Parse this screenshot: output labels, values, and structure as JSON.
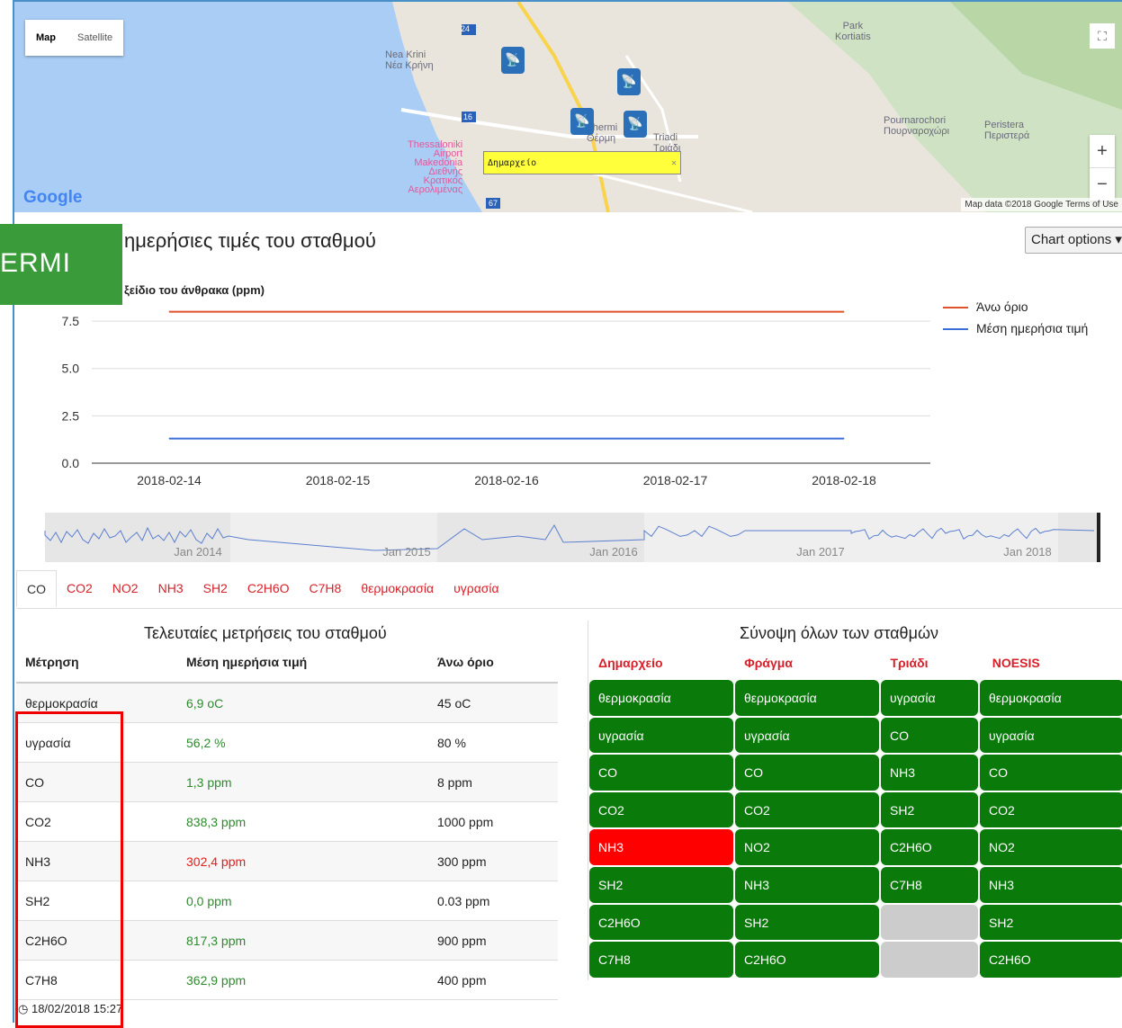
{
  "map": {
    "maptype_map": "Map",
    "maptype_satellite": "Satellite",
    "popup_label": "Δημαρχείο",
    "popup_close": "✕",
    "fullscreen_icon": "fullscreen-icon",
    "zoom_in": "+",
    "zoom_out": "−",
    "google_logo": "Google",
    "attribution": "Map data ©2018 Google   Terms of Use",
    "labels": {
      "nea_krini": "Nea Krini\nΝέα Κρήνη",
      "park": "Park\nKortiatis",
      "airport": "Thessaloniki\nAirport\nMakedonia\nΔιεθνής\nΚρατικός\nΑερολιμένας",
      "pournarochori": "Pournarochori\nΠουρναροχώρι",
      "peristera": "Peristera\nΠεριστερά",
      "triadi": "Triadi\nΤριάδι",
      "thermi": "Thermi\nΘέρμη",
      "road24": "24",
      "road16": "16",
      "road67": "67"
    }
  },
  "badge": "ERMI",
  "section_title": "ημερήσιες τιμές του σταθμού",
  "chart_options": "Chart options ▾",
  "chart_data": {
    "type": "line",
    "title": "ξείδιο του άνθρακα (ppm)",
    "x": [
      "2018-02-14",
      "2018-02-15",
      "2018-02-16",
      "2018-02-17",
      "2018-02-18"
    ],
    "series": [
      {
        "name": "Άνω όριο",
        "color": "#e0522c",
        "values": [
          8,
          8,
          8,
          8,
          8
        ]
      },
      {
        "name": "Μέση ημερήσια τιμή",
        "color": "#3c6ed8",
        "values": [
          1.3,
          1.3,
          1.3,
          1.3,
          1.3
        ]
      }
    ],
    "yticks": [
      "7.5",
      "5.0",
      "2.5",
      "0.0"
    ],
    "ylim": [
      0,
      9.5
    ],
    "navigator_labels": [
      "Jan 2014",
      "Jan 2015",
      "Jan 2016",
      "Jan 2017",
      "Jan 2018"
    ],
    "legend": "right"
  },
  "tabs": [
    "CO",
    "CO2",
    "NO2",
    "NH3",
    "SH2",
    "C2H6O",
    "C7H8",
    "θερμοκρασία",
    "υγρασία"
  ],
  "latest": {
    "title": "Τελευταίες μετρήσεις του σταθμού",
    "headers": [
      "Μέτρηση",
      "Μέση ημερήσια τιμή",
      "Άνω όριο"
    ],
    "rows": [
      {
        "name": "θερμοκρασία",
        "value": "6,9 oC",
        "limit": "45 oC",
        "status": "ok"
      },
      {
        "name": "υγρασία",
        "value": "56,2 %",
        "limit": "80 %",
        "status": "ok"
      },
      {
        "name": "CO",
        "value": "1,3 ppm",
        "limit": "8 ppm",
        "status": "ok"
      },
      {
        "name": "CO2",
        "value": "838,3 ppm",
        "limit": "1000 ppm",
        "status": "ok"
      },
      {
        "name": "NH3",
        "value": "302,4 ppm",
        "limit": "300 ppm",
        "status": "bad"
      },
      {
        "name": "SH2",
        "value": "0,0 ppm",
        "limit": "0.03 ppm",
        "status": "ok"
      },
      {
        "name": "C2H6O",
        "value": "817,3 ppm",
        "limit": "900 ppm",
        "status": "ok"
      },
      {
        "name": "C7H8",
        "value": "362,9 ppm",
        "limit": "400 ppm",
        "status": "ok"
      }
    ],
    "timestamp": "18/02/2018 15:27"
  },
  "summary": {
    "title": "Σύνοψη όλων των σταθμών",
    "stations": [
      "Δημαρχείο",
      "Φράγμα",
      "Τριάδι",
      "NOESIS"
    ],
    "rows": [
      [
        {
          "t": "θερμοκρασία",
          "s": "ok"
        },
        {
          "t": "θερμοκρασία",
          "s": "ok"
        },
        {
          "t": "υγρασία",
          "s": "ok"
        },
        {
          "t": "θερμοκρασία",
          "s": "ok"
        }
      ],
      [
        {
          "t": "υγρασία",
          "s": "ok"
        },
        {
          "t": "υγρασία",
          "s": "ok"
        },
        {
          "t": "CO",
          "s": "ok"
        },
        {
          "t": "υγρασία",
          "s": "ok"
        }
      ],
      [
        {
          "t": "CO",
          "s": "ok"
        },
        {
          "t": "CO",
          "s": "ok"
        },
        {
          "t": "NH3",
          "s": "ok"
        },
        {
          "t": "CO",
          "s": "ok"
        }
      ],
      [
        {
          "t": "CO2",
          "s": "ok"
        },
        {
          "t": "CO2",
          "s": "ok"
        },
        {
          "t": "SH2",
          "s": "ok"
        },
        {
          "t": "CO2",
          "s": "ok"
        }
      ],
      [
        {
          "t": "NH3",
          "s": "bad"
        },
        {
          "t": "NO2",
          "s": "ok"
        },
        {
          "t": "C2H6O",
          "s": "ok"
        },
        {
          "t": "NO2",
          "s": "ok"
        }
      ],
      [
        {
          "t": "SH2",
          "s": "ok"
        },
        {
          "t": "NH3",
          "s": "ok"
        },
        {
          "t": "C7H8",
          "s": "ok"
        },
        {
          "t": "NH3",
          "s": "ok"
        }
      ],
      [
        {
          "t": "C2H6O",
          "s": "ok"
        },
        {
          "t": "SH2",
          "s": "ok"
        },
        {
          "t": "",
          "s": "none"
        },
        {
          "t": "SH2",
          "s": "ok"
        }
      ],
      [
        {
          "t": "C7H8",
          "s": "ok"
        },
        {
          "t": "C2H6O",
          "s": "ok"
        },
        {
          "t": "",
          "s": "none"
        },
        {
          "t": "C2H6O",
          "s": "ok"
        }
      ]
    ]
  },
  "colors": {
    "ok": "#0a7a0a",
    "bad": "#ff0000",
    "none": "#cccccc",
    "tab_red": "#d9202a",
    "badge": "#3a9b3a"
  }
}
